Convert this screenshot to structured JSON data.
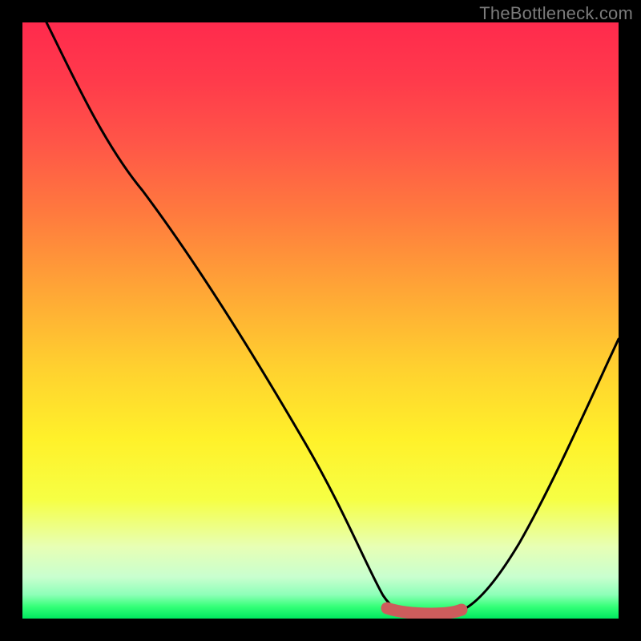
{
  "watermark": "TheBottleneck.com",
  "chart_data": {
    "type": "line",
    "title": "",
    "xlabel": "",
    "ylabel": "",
    "xlim": [
      0,
      100
    ],
    "ylim": [
      0,
      100
    ],
    "series": [
      {
        "name": "bottleneck-curve",
        "x": [
          4,
          10,
          20,
          30,
          40,
          50,
          56,
          60,
          64,
          68,
          72,
          78,
          85,
          92,
          100
        ],
        "y": [
          100,
          88,
          72,
          56,
          40,
          24,
          12,
          4,
          0,
          0,
          0,
          4,
          14,
          28,
          47
        ]
      }
    ],
    "marker_segment": {
      "name": "optimal-zone",
      "x": [
        61,
        73
      ],
      "y": [
        1.5,
        1.5
      ],
      "color": "#cd5c5c"
    },
    "colors": {
      "frame": "#000000",
      "curve": "#000000",
      "marker": "#cd5c5c",
      "gradient_top": "#ff2a4d",
      "gradient_mid": "#ffd12f",
      "gradient_bottom": "#00e85f"
    }
  }
}
